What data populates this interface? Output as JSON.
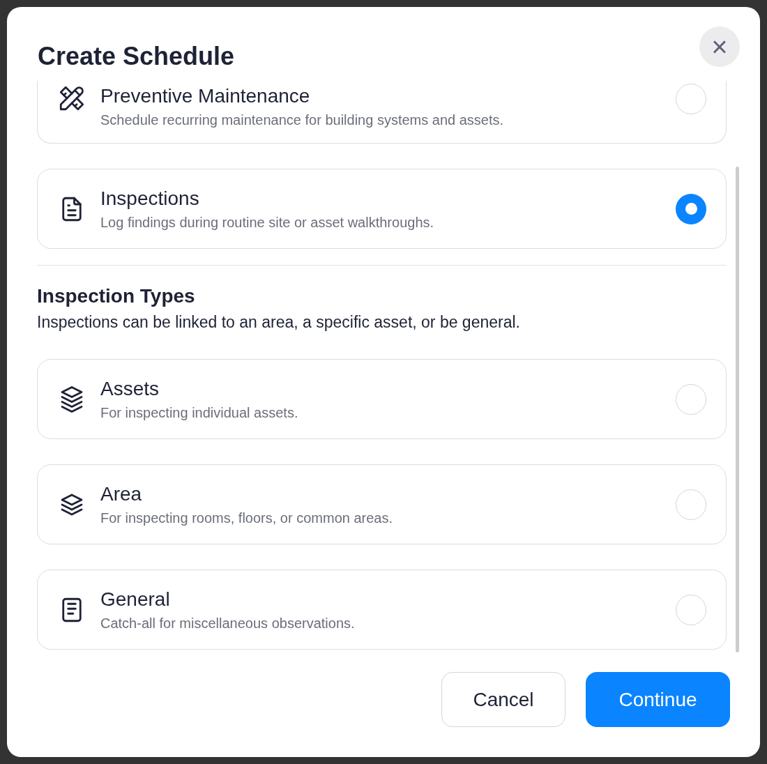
{
  "dialog": {
    "title": "Create Schedule",
    "close_label": "×"
  },
  "schedule_types": [
    {
      "kind": "tools",
      "title": "Preventive Maintenance",
      "description": "Schedule recurring maintenance for building systems and assets.",
      "selected": false
    },
    {
      "kind": "document",
      "title": "Inspections",
      "description": "Log findings during routine site or asset walkthroughs.",
      "selected": true
    }
  ],
  "inspection_types": {
    "heading": "Inspection Types",
    "description": "Inspections can be linked to an area, a specific asset, or be general.",
    "options": [
      {
        "kind": "stack",
        "title": "Assets",
        "description": "For inspecting individual assets.",
        "selected": false
      },
      {
        "kind": "layers",
        "title": "Area",
        "description": "For inspecting rooms, floors, or common areas.",
        "selected": false
      },
      {
        "kind": "notes",
        "title": "General",
        "description": "Catch-all for miscellaneous observations.",
        "selected": false
      }
    ]
  },
  "buttons": [
    {
      "label": "Cancel",
      "kind": "secondary"
    },
    {
      "label": "Continue",
      "kind": "primary"
    }
  ]
}
